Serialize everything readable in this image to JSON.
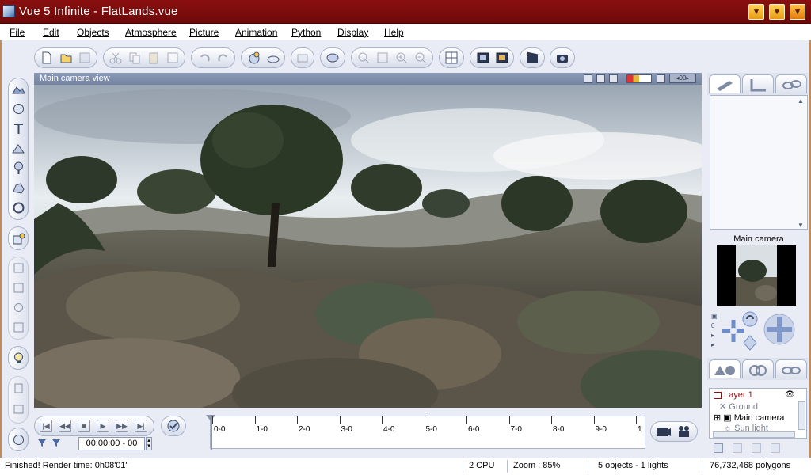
{
  "window": {
    "title": "Vue 5 Infinite - FlatLands.vue",
    "min_glyph": "▾",
    "max_glyph": "▾",
    "close_glyph": "▾"
  },
  "menu": [
    "File",
    "Edit",
    "Objects",
    "Atmosphere",
    "Picture",
    "Animation",
    "Python",
    "Display",
    "Help"
  ],
  "viewport": {
    "title": "Main camera view",
    "zoom_badge": "◂00▸"
  },
  "timeline": {
    "time": "00:00:00 - 00",
    "ticks": [
      "0-0",
      "1-0",
      "2-0",
      "3-0",
      "4-0",
      "5-0",
      "6-0",
      "7-0",
      "8-0",
      "9-0",
      "1"
    ]
  },
  "camera_panel": {
    "title": "Main camera"
  },
  "layers": {
    "layer1": "Layer 1",
    "items": [
      "Ground",
      "Main camera",
      "Sun light"
    ]
  },
  "status": {
    "message": "Finished! Render time: 0h08'01\"",
    "cpu": "2 CPU",
    "zoom": "Zoom : 85%",
    "objects": "5 objects - 1 lights",
    "polygons": "76,732,468 polygons"
  },
  "colors": {
    "titlebar": "#7a0c0c",
    "frame": "#e9ecf5",
    "accent": "#4a6aa8"
  }
}
